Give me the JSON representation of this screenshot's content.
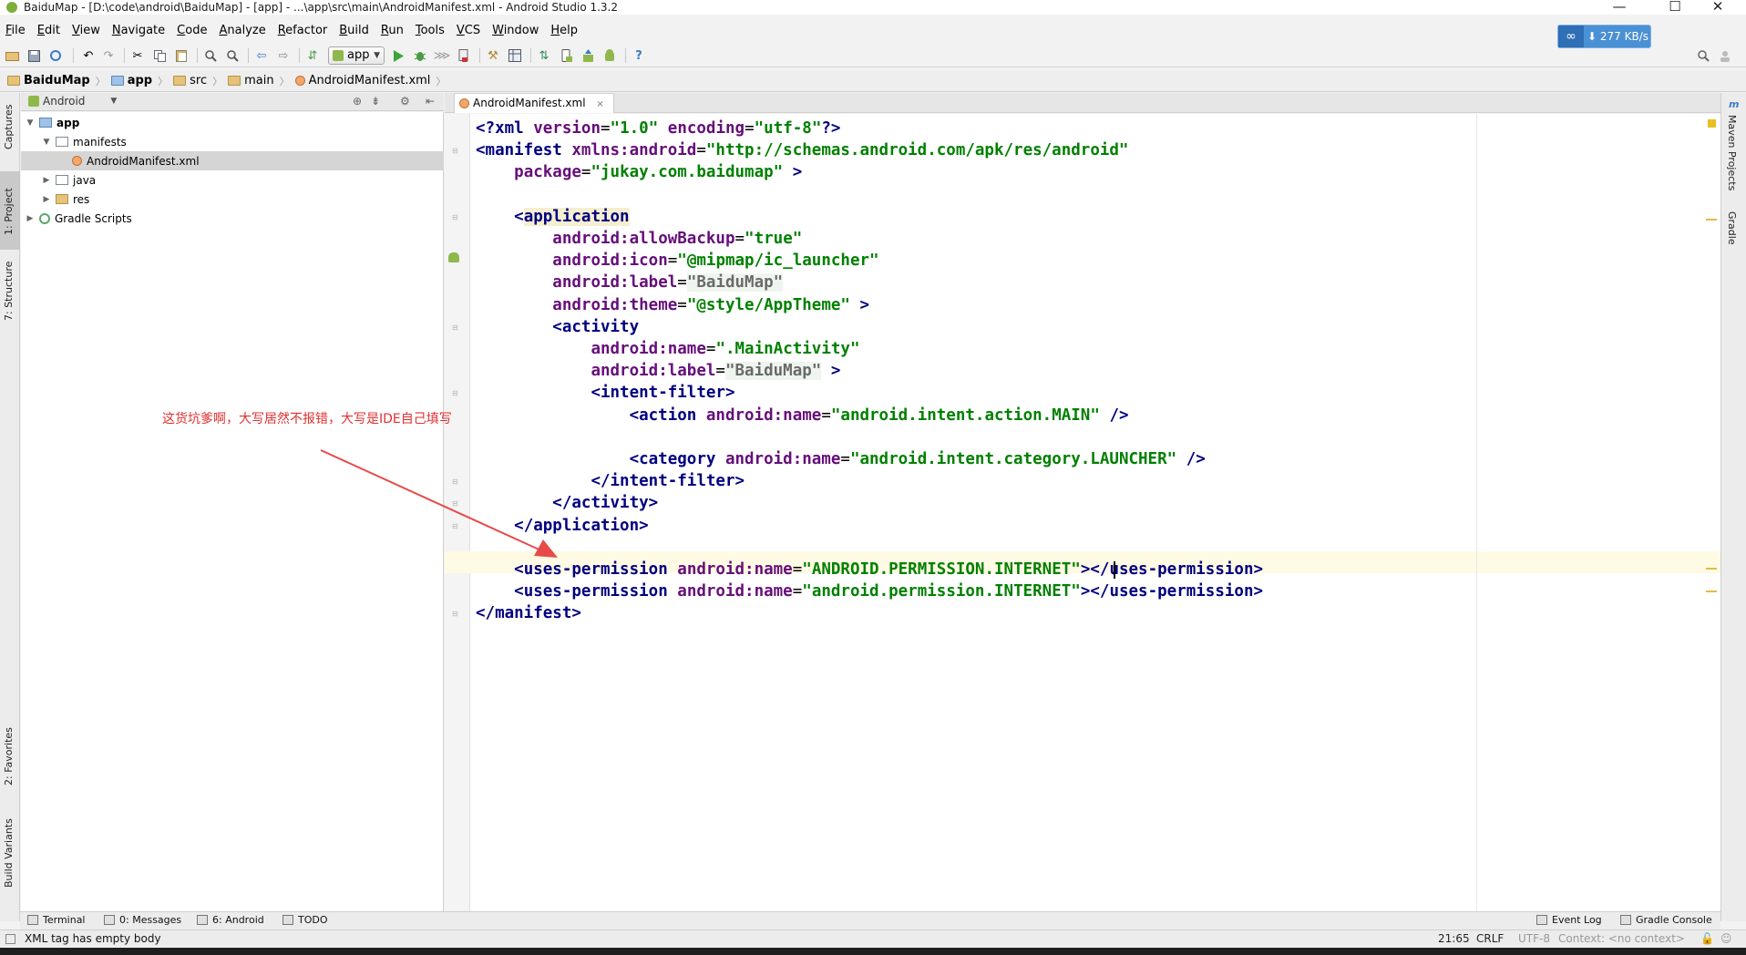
{
  "window": {
    "title": "BaiduMap - [D:\\code\\android\\BaiduMap] - [app] - ...\\app\\src\\main\\AndroidManifest.xml - Android Studio 1.3.2",
    "minimize": "—",
    "maximize": "☐",
    "close": "✕"
  },
  "menu": [
    "File",
    "Edit",
    "View",
    "Navigate",
    "Code",
    "Analyze",
    "Refactor",
    "Build",
    "Run",
    "Tools",
    "VCS",
    "Window",
    "Help"
  ],
  "toolbar": {
    "run_config": "app",
    "net_speed": "277 KB/s",
    "net_arrow": "⬇"
  },
  "breadcrumb": [
    {
      "label": "BaiduMap",
      "bold": true
    },
    {
      "label": "app",
      "bold": true
    },
    {
      "label": "src",
      "bold": false
    },
    {
      "label": "main",
      "bold": false
    },
    {
      "label": "AndroidManifest.xml",
      "bold": false
    }
  ],
  "left_strip": {
    "captures": "Captures",
    "project": "1: Project",
    "structure": "7: Structure",
    "favorites": "2: Favorites",
    "build_variants": "Build Variants"
  },
  "right_strip": {
    "maven": "Maven Projects",
    "gradle": "Gradle",
    "maven_letter": "m"
  },
  "project_panel": {
    "view": "Android",
    "tree": [
      {
        "label": "app",
        "depth": 0,
        "arrow": "▼",
        "kind": "mod"
      },
      {
        "label": "manifests",
        "depth": 1,
        "arrow": "▼",
        "kind": "plain"
      },
      {
        "label": "AndroidManifest.xml",
        "depth": 2,
        "arrow": "",
        "kind": "xml"
      },
      {
        "label": "java",
        "depth": 1,
        "arrow": "▶",
        "kind": "plain"
      },
      {
        "label": "res",
        "depth": 1,
        "arrow": "▶",
        "kind": "folder"
      },
      {
        "label": "Gradle Scripts",
        "depth": 0,
        "arrow": "▶",
        "kind": "gr"
      }
    ]
  },
  "editor": {
    "tab": "AndroidManifest.xml",
    "tab_close": "×"
  },
  "annotation": "这货坑爹啊，大写居然不报错，大写是IDE自己填写",
  "bottom_tabs": [
    "Terminal",
    "0: Messages",
    "6: Android",
    "TODO"
  ],
  "bottom_right_tabs": [
    "Event Log",
    "Gradle Console"
  ],
  "status": {
    "message": "XML tag has empty body",
    "position": "21:65",
    "line_sep": "CRLF",
    "encoding": "UTF-8",
    "context": "Context: <no context>"
  },
  "code_lines": [
    [
      [
        "t-tag",
        "<?"
      ],
      [
        "t-tag",
        "xml "
      ],
      [
        "t-attr",
        "version"
      ],
      [
        "t-plain",
        "="
      ],
      [
        "t-val",
        "\"1.0\""
      ],
      [
        "t-plain",
        " "
      ],
      [
        "t-attr",
        "encoding"
      ],
      [
        "t-plain",
        "="
      ],
      [
        "t-val",
        "\"utf-8\""
      ],
      [
        "t-tag",
        "?>"
      ]
    ],
    [
      [
        "t-tag",
        "<manifest "
      ],
      [
        "t-ns",
        "xmlns:"
      ],
      [
        "t-attr",
        "android"
      ],
      [
        "t-plain",
        "="
      ],
      [
        "t-val",
        "\"http://schemas.android.com/apk/res/android\""
      ]
    ],
    [
      [
        "t-plain",
        "    "
      ],
      [
        "t-attr",
        "package"
      ],
      [
        "t-plain",
        "="
      ],
      [
        "t-val",
        "\"jukay.com.baidumap\""
      ],
      [
        "t-plain",
        " "
      ],
      [
        "t-tag",
        ">"
      ]
    ],
    [
      [
        "t-plain",
        ""
      ]
    ],
    [
      [
        "t-plain",
        "    "
      ],
      [
        "t-tag",
        "<"
      ],
      [
        "t-tag t-hl",
        "application"
      ]
    ],
    [
      [
        "t-plain",
        "        "
      ],
      [
        "t-ns",
        "android:"
      ],
      [
        "t-attr",
        "allowBackup"
      ],
      [
        "t-plain",
        "="
      ],
      [
        "t-val",
        "\"true\""
      ]
    ],
    [
      [
        "t-plain",
        "        "
      ],
      [
        "t-ns",
        "android:"
      ],
      [
        "t-attr",
        "icon"
      ],
      [
        "t-plain",
        "="
      ],
      [
        "t-val",
        "\"@mipmap/ic_launcher\""
      ]
    ],
    [
      [
        "t-plain",
        "        "
      ],
      [
        "t-ns",
        "android:"
      ],
      [
        "t-attr",
        "label"
      ],
      [
        "t-plain",
        "="
      ],
      [
        "t-val ref",
        "\"BaiduMap\""
      ]
    ],
    [
      [
        "t-plain",
        "        "
      ],
      [
        "t-ns",
        "android:"
      ],
      [
        "t-attr",
        "theme"
      ],
      [
        "t-plain",
        "="
      ],
      [
        "t-val",
        "\"@style/AppTheme\""
      ],
      [
        "t-plain",
        " "
      ],
      [
        "t-tag",
        ">"
      ]
    ],
    [
      [
        "t-plain",
        "        "
      ],
      [
        "t-tag",
        "<activity"
      ]
    ],
    [
      [
        "t-plain",
        "            "
      ],
      [
        "t-ns",
        "android:"
      ],
      [
        "t-attr",
        "name"
      ],
      [
        "t-plain",
        "="
      ],
      [
        "t-val",
        "\".MainActivity\""
      ]
    ],
    [
      [
        "t-plain",
        "            "
      ],
      [
        "t-ns",
        "android:"
      ],
      [
        "t-attr",
        "label"
      ],
      [
        "t-plain",
        "="
      ],
      [
        "t-val ref",
        "\"BaiduMap\""
      ],
      [
        "t-plain",
        " "
      ],
      [
        "t-tag",
        ">"
      ]
    ],
    [
      [
        "t-plain",
        "            "
      ],
      [
        "t-tag",
        "<intent-filter>"
      ]
    ],
    [
      [
        "t-plain",
        "                "
      ],
      [
        "t-tag",
        "<action "
      ],
      [
        "t-ns",
        "android:"
      ],
      [
        "t-attr",
        "name"
      ],
      [
        "t-plain",
        "="
      ],
      [
        "t-val",
        "\"android.intent.action.MAIN\""
      ],
      [
        "t-plain",
        " "
      ],
      [
        "t-tag",
        "/>"
      ]
    ],
    [
      [
        "t-plain",
        ""
      ]
    ],
    [
      [
        "t-plain",
        "                "
      ],
      [
        "t-tag",
        "<category "
      ],
      [
        "t-ns",
        "android:"
      ],
      [
        "t-attr",
        "name"
      ],
      [
        "t-plain",
        "="
      ],
      [
        "t-val",
        "\"android.intent.category.LAUNCHER\""
      ],
      [
        "t-plain",
        " "
      ],
      [
        "t-tag",
        "/>"
      ]
    ],
    [
      [
        "t-plain",
        "            "
      ],
      [
        "t-tag",
        "</intent-filter>"
      ]
    ],
    [
      [
        "t-plain",
        "        "
      ],
      [
        "t-tag",
        "</activity>"
      ]
    ],
    [
      [
        "t-plain",
        "    "
      ],
      [
        "t-tag",
        "</application>"
      ]
    ],
    [
      [
        "t-plain",
        ""
      ]
    ],
    [
      [
        "t-plain",
        "    "
      ],
      [
        "t-tag",
        "<uses-permission "
      ],
      [
        "t-ns",
        "android:"
      ],
      [
        "t-attr",
        "name"
      ],
      [
        "t-plain",
        "="
      ],
      [
        "t-val",
        "\"ANDROID.PERMISSION.INTERNET\""
      ],
      [
        "t-tag",
        ">"
      ],
      [
        "t-tag",
        "</uses-permission>"
      ]
    ],
    [
      [
        "t-plain",
        "    "
      ],
      [
        "t-tag",
        "<uses-permission "
      ],
      [
        "t-ns",
        "android:"
      ],
      [
        "t-attr",
        "name"
      ],
      [
        "t-plain",
        "="
      ],
      [
        "t-val",
        "\"android.permission.INTERNET\""
      ],
      [
        "t-tag",
        ">"
      ],
      [
        "t-tag",
        "</uses-permission>"
      ]
    ],
    [
      [
        "t-tag",
        "</manifest>"
      ]
    ]
  ]
}
